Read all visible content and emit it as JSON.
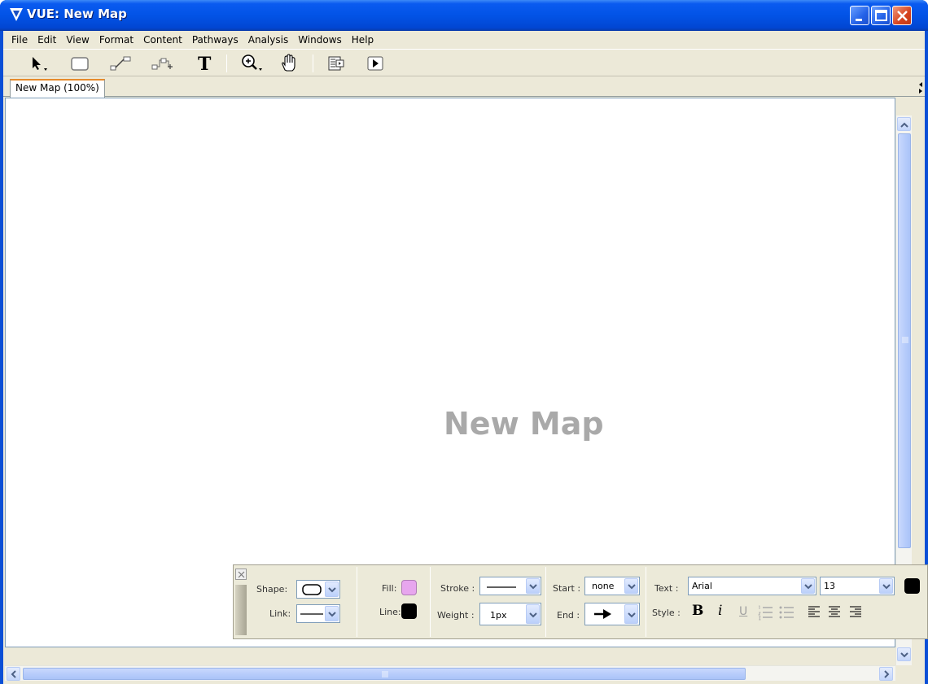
{
  "window": {
    "title": "VUE: New Map"
  },
  "menubar": {
    "items": [
      "File",
      "Edit",
      "View",
      "Format",
      "Content",
      "Pathways",
      "Analysis",
      "Windows",
      "Help"
    ]
  },
  "toolbar": {
    "icons": [
      "selection-arrow-icon",
      "node-rectangle-icon",
      "link-tool-icon",
      "curved-link-icon",
      "text-tool-icon",
      "zoom-icon",
      "hand-pan-icon",
      "presentation-notes-icon",
      "play-presentation-icon"
    ]
  },
  "tabs": [
    {
      "label": "New Map (100%)"
    }
  ],
  "canvas": {
    "watermark": "New Map"
  },
  "palette": {
    "shape_label": "Shape:",
    "link_label": "Link:",
    "fill_label": "Fill:",
    "fill_color": "#e7a6ee",
    "line_label": "Line:",
    "line_color": "#000000",
    "stroke_label": "Stroke :",
    "weight_label": "Weight :",
    "weight_value": "1px",
    "start_label": "Start :",
    "start_value": "none",
    "end_label": "End :",
    "text_label": "Text :",
    "font_value": "Arial",
    "size_value": "13",
    "text_color": "#000000",
    "style_label": "Style :",
    "bold_label": "B",
    "italic_label": "i",
    "underline_label": "U"
  },
  "colors": {
    "titlebar": "#0253e6",
    "chrome": "#ece9d8",
    "watermark": "#a9a9a9",
    "tab_accent": "#e68b2c"
  }
}
